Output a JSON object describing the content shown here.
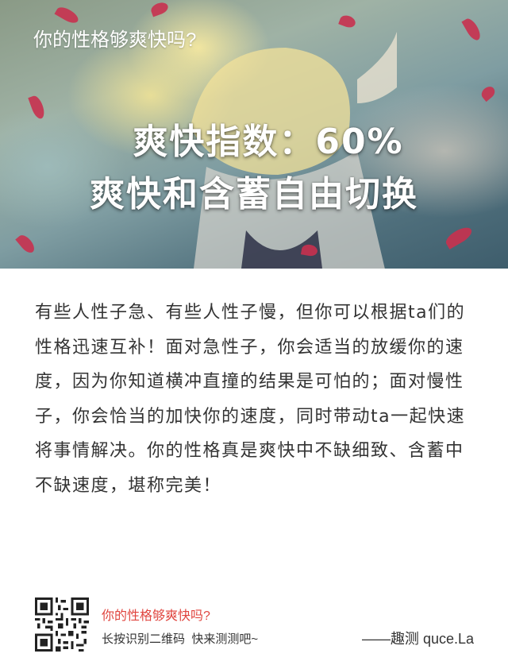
{
  "hero": {
    "title": "你的性格够爽快吗?",
    "score_line": "爽快指数：60%",
    "result_line": "爽快和含蓄自由切换",
    "petal_color": "#c8314f"
  },
  "description": "有些人性子急、有些人性子慢，但你可以根据ta们的性格迅速互补！面对急性子，你会适当的放缓你的速度，因为你知道横冲直撞的结果是可怕的；面对慢性子，你会恰当的加快你的速度，同时带动ta一起快速将事情解决。你的性格真是爽快中不缺细致、含蓄中不缺速度，堪称完美！",
  "footer": {
    "title": "你的性格够爽快吗?",
    "hint": "长按识别二维码  快来测测吧~",
    "brand": "——趣测 quce.La",
    "qr_icon": "qr-code-icon",
    "title_color": "#e0453f"
  }
}
